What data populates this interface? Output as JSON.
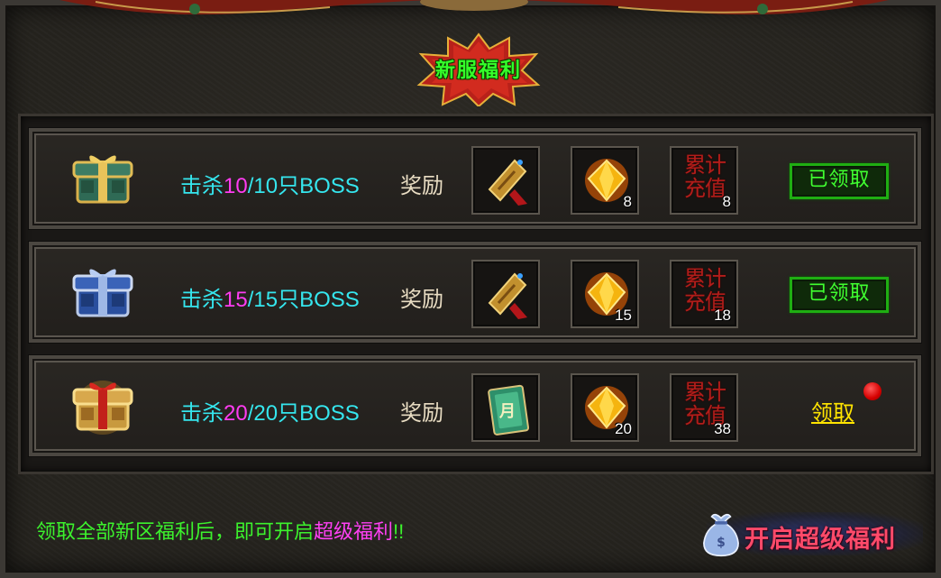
{
  "title": "新服福利",
  "reward_label": "奖励",
  "rows": [
    {
      "kill_prefix": "击杀",
      "kill_current": "10",
      "kill_suffix": "/10只BOSS",
      "chest": "green-chest",
      "items": [
        {
          "icon": "medal-icon",
          "count": ""
        },
        {
          "icon": "gem-icon",
          "count": "8"
        },
        {
          "icon": "recharge-icon",
          "text": "累计充值",
          "count": "8"
        }
      ],
      "status": "claimed",
      "status_label": "已领取"
    },
    {
      "kill_prefix": "击杀",
      "kill_current": "15",
      "kill_suffix": "/15只BOSS",
      "chest": "blue-chest",
      "items": [
        {
          "icon": "medal-icon",
          "count": ""
        },
        {
          "icon": "gem-icon",
          "count": "15"
        },
        {
          "icon": "recharge-icon",
          "text": "累计充值",
          "count": "18"
        }
      ],
      "status": "claimed",
      "status_label": "已领取"
    },
    {
      "kill_prefix": "击杀",
      "kill_current": "20",
      "kill_suffix": "/20只BOSS",
      "chest": "red-chest",
      "items": [
        {
          "icon": "monthly-card-icon",
          "text": "月",
          "count": ""
        },
        {
          "icon": "gem-icon",
          "count": "20"
        },
        {
          "icon": "recharge-icon",
          "text": "累计充值",
          "count": "38"
        }
      ],
      "status": "available",
      "status_label": "领取"
    }
  ],
  "footer": {
    "note_prefix": "领取全部新区福利后，即可开启",
    "note_highlight": "超级福利",
    "note_suffix": "!!"
  },
  "super_button": {
    "label": "开启超级福利",
    "icon": "money-bag-icon"
  },
  "colors": {
    "title": "#35ff2a",
    "kill_text": "#35e6ee",
    "kill_number": "#ff3cf2",
    "claimed": "#40ff30",
    "claim_link": "#ffe400",
    "recharge_text": "#b21d1a"
  }
}
